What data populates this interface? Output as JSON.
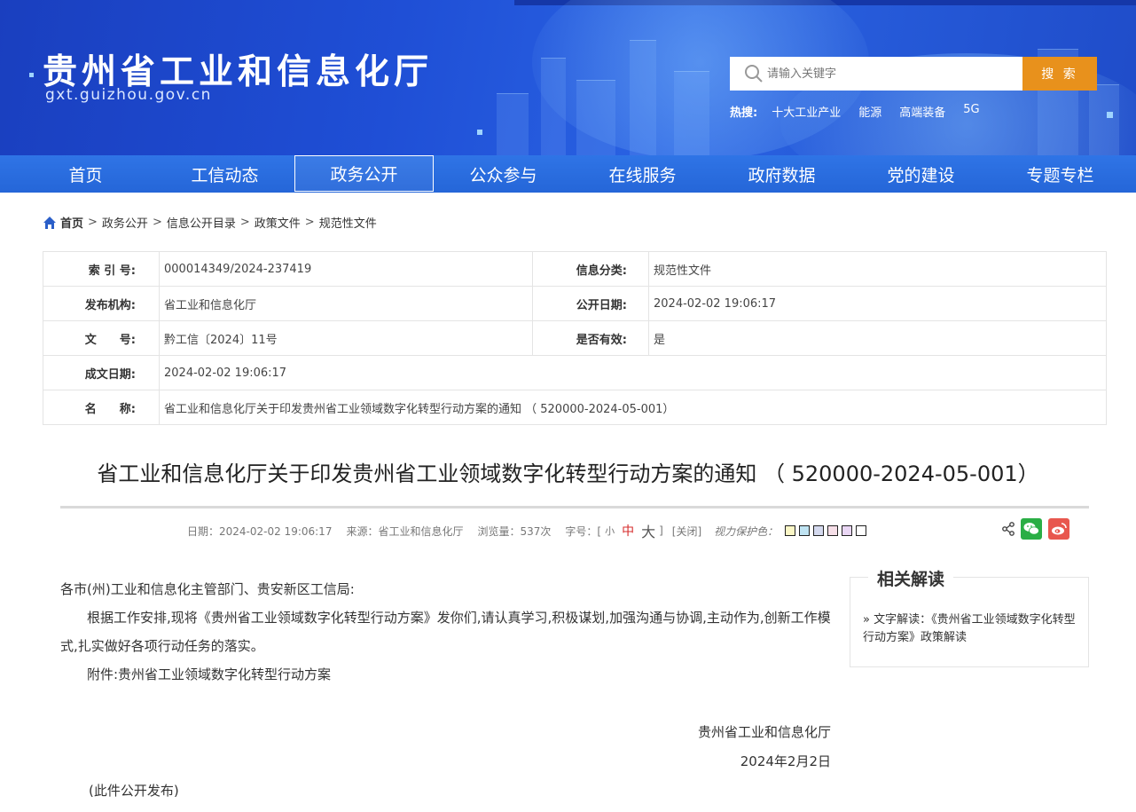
{
  "header": {
    "site_title": "贵州省工业和信息化厅",
    "site_url": "gxt.guizhou.gov.cn",
    "search": {
      "placeholder": "请输入关键字",
      "button_label": "搜 索"
    },
    "hot": {
      "label": "热搜:",
      "items": [
        "十大工业产业",
        "能源",
        "高端装备",
        "5G"
      ]
    }
  },
  "nav": {
    "items": [
      "首页",
      "工信动态",
      "政务公开",
      "公众参与",
      "在线服务",
      "政府数据",
      "党的建设",
      "专题专栏"
    ],
    "active": "政务公开"
  },
  "breadcrumb": [
    "首页",
    "政务公开",
    "信息公开目录",
    "政策文件",
    "规范性文件"
  ],
  "info": {
    "index_no_label": "索 引 号:",
    "index_no": "000014349/2024-237419",
    "category_label": "信息分类:",
    "category": "规范性文件",
    "publisher_label": "发布机构:",
    "publisher": "省工业和信息化厅",
    "publish_date_label": "公开日期:",
    "publish_date": "2024-02-02 19:06:17",
    "doc_no_label": "文　　号:",
    "doc_no": "黔工信〔2024〕11号",
    "valid_label": "是否有效:",
    "valid": "是",
    "written_date_label": "成文日期:",
    "written_date": "2024-02-02 19:06:17",
    "name_label": "名　　称:",
    "name": "省工业和信息化厅关于印发贵州省工业领域数字化转型行动方案的通知 （ 520000-2024-05-001）"
  },
  "article": {
    "title": "省工业和信息化厅关于印发贵州省工业领域数字化转型行动方案的通知 （ 520000-2024-05-001）",
    "meta": {
      "date": "日期：2024-02-02 19:06:17",
      "source": "来源：省工业和信息化厅",
      "views": "浏览量：537次",
      "font_size_label": "字号：[",
      "font_small": "小",
      "font_mid": "中",
      "font_big": "大",
      "font_size_end": "]",
      "close": "[关闭]",
      "vision_label": "视力保护色："
    },
    "swatch_colors": [
      "#fbf7c6",
      "#bfe3f2",
      "#d4d9ee",
      "#f6dfe8",
      "#e9d6f4",
      "#ffffff"
    ],
    "salutation": "各市(州)工业和信息化主管部门、贵安新区工信局:",
    "paragraph": "根据工作安排,现将《贵州省工业领域数字化转型行动方案》发你们,请认真学习,积极谋划,加强沟通与协调,主动作为,创新工作模式,扎实做好各项行动任务的落实。",
    "attachment": "附件:贵州省工业领域数字化转型行动方案",
    "signature_org": "贵州省工业和信息化厅",
    "signature_date": "2024年2月2日",
    "note": "(此件公开发布)"
  },
  "related": {
    "title": "相关解读",
    "link": "» 文字解读：《贵州省工业领域数字化转型 行动方案》政策解读"
  },
  "colors": {
    "header_blue": "#1f4fd6",
    "nav_blue": "#2566d8",
    "search_orange": "#e8911c",
    "wechat_green": "#2aae45",
    "weibo_red": "#e8574e"
  }
}
